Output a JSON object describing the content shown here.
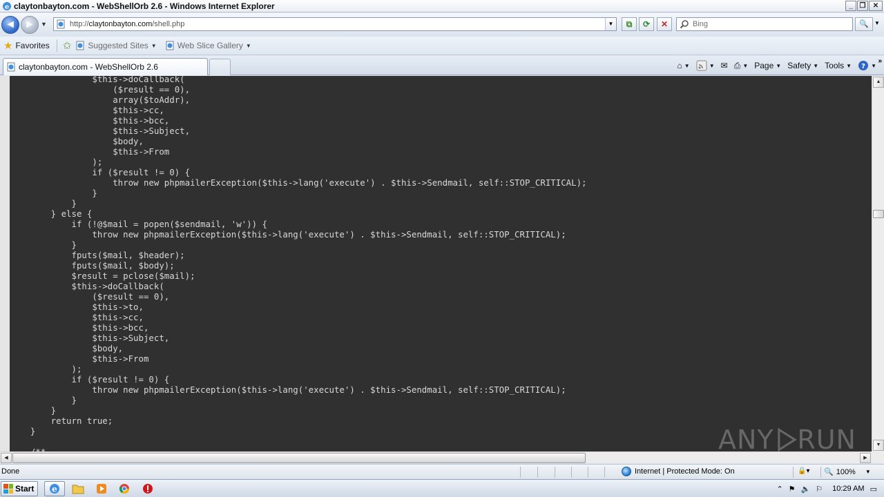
{
  "window": {
    "title": "claytonbayton.com - WebShellOrb 2.6 - Windows Internet Explorer",
    "controls": [
      "_",
      "❐",
      "✕"
    ]
  },
  "nav": {
    "back_icon": "◄",
    "forward_icon": "►",
    "url_prefix": "http://",
    "url_host": "claytonbayton.com",
    "url_path": "/shell.php",
    "search_placeholder": "Bing"
  },
  "favorites_bar": {
    "favorites_label": "Favorites",
    "items": [
      {
        "label": "Suggested Sites"
      },
      {
        "label": "Web Slice Gallery"
      }
    ]
  },
  "tabs": [
    {
      "title": "claytonbayton.com - WebShellOrb 2.6",
      "active": true
    }
  ],
  "command_bar": {
    "page_label": "Page",
    "safety_label": "Safety",
    "tools_label": "Tools",
    "more": "»"
  },
  "code_lines": [
    "                $this->doCallback(",
    "                    ($result == 0),",
    "                    array($toAddr),",
    "                    $this->cc,",
    "                    $this->bcc,",
    "                    $this->Subject,",
    "                    $body,",
    "                    $this->From",
    "                );",
    "                if ($result != 0) {",
    "                    throw new phpmailerException($this->lang('execute') . $this->Sendmail, self::STOP_CRITICAL);",
    "                }",
    "            }",
    "        } else {",
    "            if (!@$mail = popen($sendmail, 'w')) {",
    "                throw new phpmailerException($this->lang('execute') . $this->Sendmail, self::STOP_CRITICAL);",
    "            }",
    "            fputs($mail, $header);",
    "            fputs($mail, $body);",
    "            $result = pclose($mail);",
    "            $this->doCallback(",
    "                ($result == 0),",
    "                $this->to,",
    "                $this->cc,",
    "                $this->bcc,",
    "                $this->Subject,",
    "                $body,",
    "                $this->From",
    "            );",
    "            if ($result != 0) {",
    "                throw new phpmailerException($this->lang('execute') . $this->Sendmail, self::STOP_CRITICAL);",
    "            }",
    "        }",
    "        return true;",
    "    }",
    "",
    "    /**"
  ],
  "watermark": {
    "left": "ANY",
    "right": "RUN"
  },
  "status_bar": {
    "status_text": "Done",
    "zone_text": "Internet | Protected Mode: On",
    "zoom_text": "100%"
  },
  "taskbar": {
    "start_label": "Start",
    "clock": "10:29 AM",
    "apps": [
      "ie-icon",
      "explorer-folder-icon",
      "media-player-icon",
      "chrome-icon",
      "avast-icon"
    ]
  },
  "colors": {
    "code_bg": "#303030",
    "code_fg": "#d8d8d8",
    "ie_blue": "#2e66c6"
  }
}
